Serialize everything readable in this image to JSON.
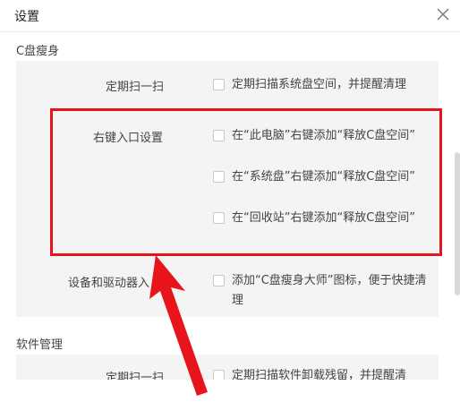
{
  "dialog": {
    "title": "设置"
  },
  "sections": {
    "cdisk": {
      "label": "C盘瘦身",
      "rows": {
        "schedule": {
          "label": "定期扫一扫",
          "option": "定期扫描系统盘空间，并提醒清理"
        },
        "context_menu": {
          "label": "右键入口设置",
          "options": [
            "在“此电脑”右键添加“释放C盘空间”",
            "在“系统盘”右键添加“释放C盘空间”",
            "在“回收站”右键添加“释放C盘空间”"
          ]
        },
        "devices": {
          "label": "设备和驱动器入",
          "option": "添加“C盘瘦身大师”图标，便于快捷清理"
        }
      }
    },
    "software": {
      "label": "软件管理",
      "rows": {
        "schedule": {
          "label": "定期扫一扫",
          "option": "定期扫描软件卸载残留，并提醒清"
        }
      }
    }
  },
  "annotation_color": "#e8141c"
}
